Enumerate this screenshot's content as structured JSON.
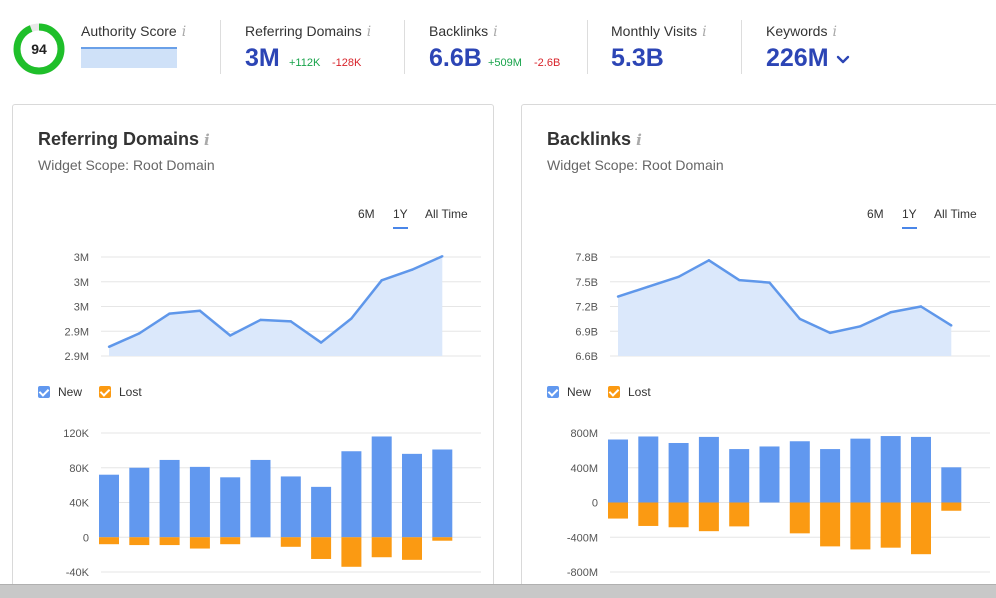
{
  "info_glyph": "i",
  "authority_score": {
    "label": "Authority Score",
    "value": "94",
    "percent": 0.94,
    "ring_color": "#1fbf2a"
  },
  "referring_domains": {
    "label": "Referring Domains",
    "value": "3M",
    "delta_up": "+112K",
    "delta_down": "-128K"
  },
  "backlinks": {
    "label": "Backlinks",
    "value": "6.6B",
    "delta_up": "+509M",
    "delta_down": "-2.6B"
  },
  "monthly_visits": {
    "label": "Monthly Visits",
    "value": "5.3B"
  },
  "keywords": {
    "label": "Keywords",
    "value": "226M",
    "dropdown_icon": "chevron-down-icon"
  },
  "colors": {
    "new": "#6198ef",
    "lost": "#fb9a12",
    "line": "#5f97ea",
    "area": "#dbe8fb",
    "value_blue": "#2c45b5"
  },
  "time_ranges": [
    "6M",
    "1Y",
    "All Time"
  ],
  "active_range": "1Y",
  "legend": {
    "new": "New",
    "lost": "Lost"
  },
  "cards": [
    {
      "title": "Referring Domains",
      "scope": "Widget Scope: Root Domain",
      "chart_data": [
        {
          "type": "area",
          "title": "",
          "y_ticks": [
            "3M",
            "3M",
            "3M",
            "2.9M",
            "2.9M"
          ],
          "ylim": [
            2.88,
            3.02
          ],
          "series": [
            {
              "values": [
                2.893,
                2.912,
                2.94,
                2.944,
                2.909,
                2.931,
                2.929,
                2.899,
                2.933,
                2.987,
                3.002,
                3.021
              ]
            }
          ]
        },
        {
          "type": "bar",
          "title": "",
          "y_ticks": [
            "120K",
            "80K",
            "40K",
            "0",
            "-40K"
          ],
          "ylim": [
            -40,
            120
          ],
          "grid_values": [
            120,
            80,
            40,
            0,
            -40
          ],
          "series": [
            {
              "name": "New",
              "values": [
                72,
                80,
                89,
                81,
                69,
                89,
                70,
                58,
                99,
                116,
                96,
                101
              ]
            },
            {
              "name": "Lost",
              "values": [
                -8,
                -9,
                -9,
                -13,
                -8,
                0,
                -11,
                -25,
                -34,
                -23,
                -26,
                -4
              ]
            }
          ]
        }
      ]
    },
    {
      "title": "Backlinks",
      "scope": "Widget Scope: Root Domain",
      "chart_data": [
        {
          "type": "area",
          "title": "",
          "y_ticks": [
            "7.8B",
            "7.5B",
            "7.2B",
            "6.9B",
            "6.6B"
          ],
          "ylim": [
            6.6,
            7.8
          ],
          "series": [
            {
              "values": [
                7.32,
                7.44,
                7.56,
                7.76,
                7.52,
                7.49,
                7.05,
                6.88,
                6.96,
                7.13,
                7.2,
                6.97
              ]
            }
          ]
        },
        {
          "type": "bar",
          "title": "",
          "y_ticks": [
            "800M",
            "400M",
            "0",
            "-400M",
            "-800M"
          ],
          "ylim": [
            -800,
            800
          ],
          "grid_values": [
            800,
            400,
            0,
            -400,
            -800
          ],
          "series": [
            {
              "name": "New",
              "values": [
                725,
                760,
                685,
                755,
                615,
                645,
                705,
                615,
                735,
                765,
                755,
                405
              ]
            },
            {
              "name": "Lost",
              "values": [
                -185,
                -270,
                -285,
                -330,
                -275,
                0,
                -355,
                -505,
                -540,
                -520,
                -595,
                -95
              ]
            }
          ]
        }
      ]
    }
  ]
}
